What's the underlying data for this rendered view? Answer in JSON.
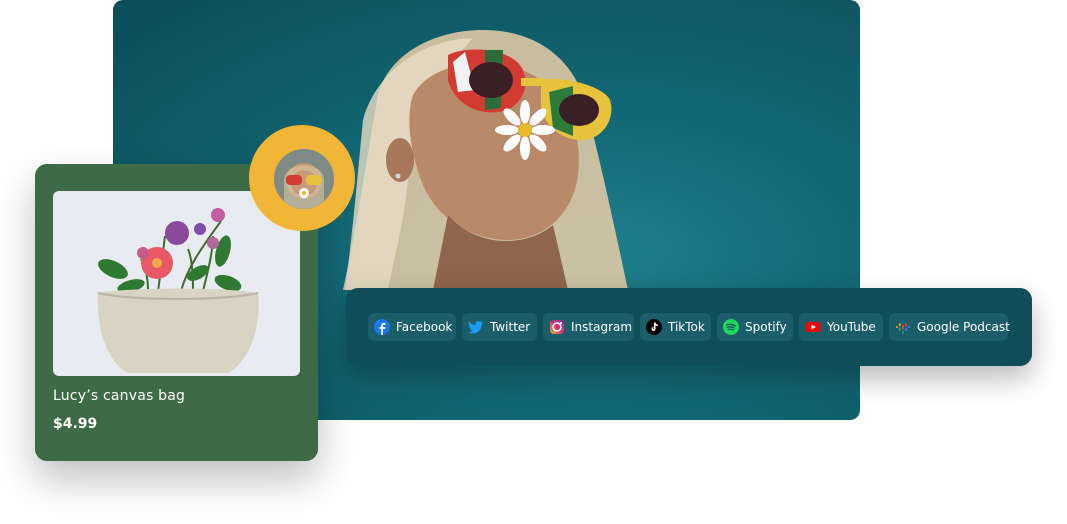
{
  "product": {
    "name": "Lucy’s canvas bag",
    "price": "$4.99"
  },
  "social": {
    "links": [
      {
        "label": "Facebook",
        "icon": "facebook-icon"
      },
      {
        "label": "Twitter",
        "icon": "twitter-icon"
      },
      {
        "label": "Instagram",
        "icon": "instagram-icon"
      },
      {
        "label": "TikTok",
        "icon": "tiktok-icon"
      },
      {
        "label": "Spotify",
        "icon": "spotify-icon"
      },
      {
        "label": "YouTube",
        "icon": "youtube-icon"
      },
      {
        "label": "Google Podcast",
        "icon": "google-podcast-icon"
      }
    ]
  },
  "colors": {
    "hero_bg": "#126774",
    "card_bg": "#3e6b45",
    "avatar_ring": "#f3b535",
    "social_bar_bg": "#0f4d58",
    "chip_bg": "#1b5d68"
  }
}
